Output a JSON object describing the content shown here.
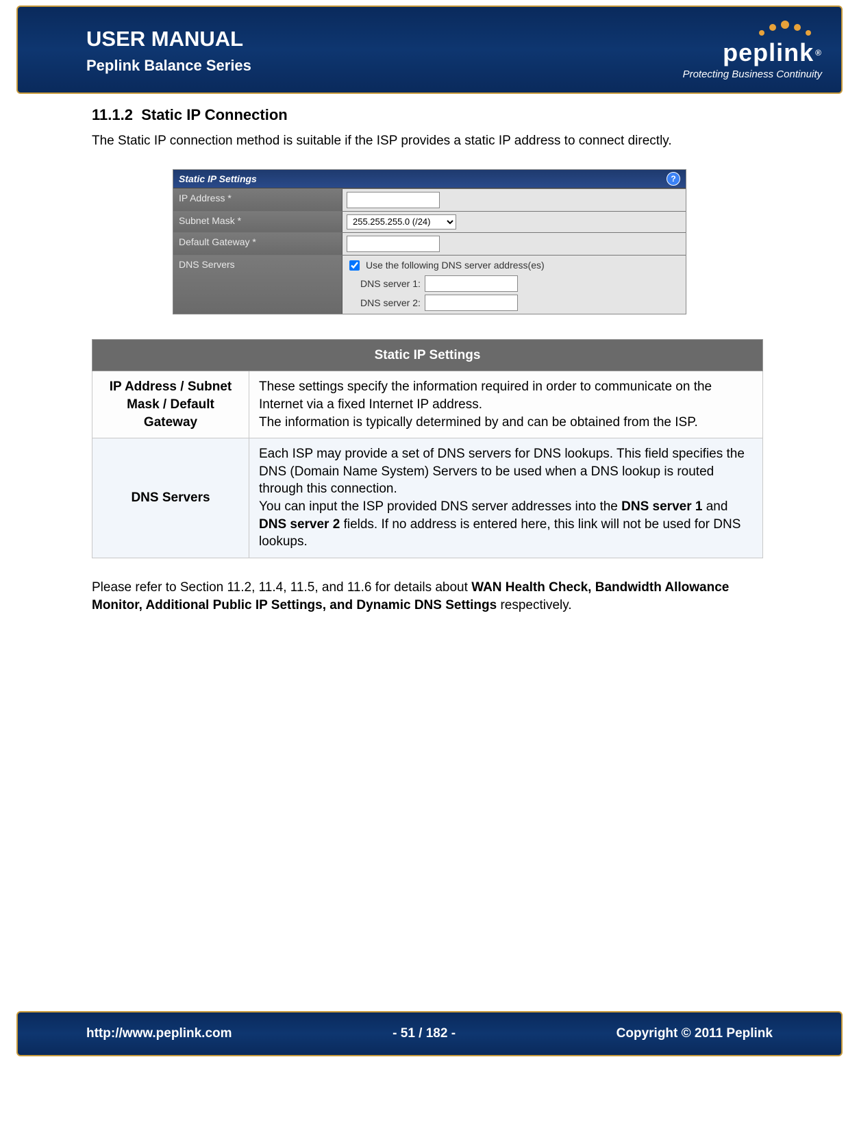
{
  "header": {
    "title": "USER MANUAL",
    "subtitle": "Peplink Balance Series",
    "logo_text": "peplink",
    "tagline": "Protecting Business Continuity"
  },
  "section": {
    "number": "11.1.2",
    "title": "Static IP Connection",
    "intro": "The Static IP connection method is suitable if the ISP provides a static IP address to connect directly."
  },
  "screenshot": {
    "panel_title": "Static IP Settings",
    "help_symbol": "?",
    "rows": {
      "ip_address_label": "IP Address *",
      "subnet_mask_label": "Subnet Mask *",
      "subnet_mask_value": "255.255.255.0 (/24)",
      "default_gateway_label": "Default Gateway *",
      "dns_servers_label": "DNS Servers",
      "use_following_label": "Use the following DNS server address(es)",
      "dns_server_1_label": "DNS server 1:",
      "dns_server_2_label": "DNS server 2:"
    }
  },
  "desc_table": {
    "header": "Static IP Settings",
    "row1": {
      "label": "IP Address / Subnet Mask / Default Gateway",
      "p1": "These settings specify the information required in order to communicate on the Internet via a fixed Internet IP address.",
      "p2": "The information is typically determined by and can be obtained from the ISP."
    },
    "row2": {
      "label": "DNS Servers",
      "p1": "Each ISP may provide a set of DNS servers for DNS lookups.  This field specifies the DNS (Domain Name System) Servers to be used when a DNS lookup is routed through this connection.",
      "p2a": "You can input the ISP provided DNS server addresses into the ",
      "p2b": "DNS server 1",
      "p2c": " and ",
      "p2d": "DNS server 2",
      "p2e": " fields.  If no address is entered here, this link will not be used for DNS lookups."
    }
  },
  "footnote": {
    "pre": "Please refer to Section 11.2, 11.4, 11.5, and 11.6 for details about ",
    "bold": "WAN Health Check, Bandwidth Allowance Monitor, Additional Public IP Settings, and Dynamic DNS Settings",
    "post": " respectively."
  },
  "footer": {
    "url": "http://www.peplink.com",
    "page": "- 51 / 182 -",
    "copyright": "Copyright © 2011 Peplink"
  }
}
